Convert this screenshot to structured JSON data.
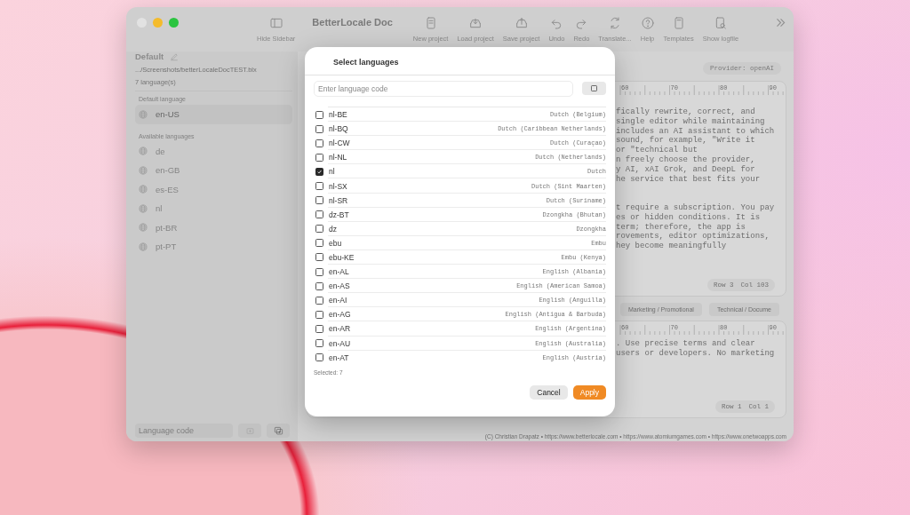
{
  "window": {
    "title": "BetterLocale Doc"
  },
  "toolbar": [
    {
      "kind": "sidebar",
      "label": "Hide Sidebar"
    },
    {
      "kind": "new",
      "label": "New project"
    },
    {
      "kind": "load",
      "label": "Load project"
    },
    {
      "kind": "save",
      "label": "Save project"
    },
    {
      "kind": "undo",
      "label": "Undo"
    },
    {
      "kind": "redo",
      "label": "Redo"
    },
    {
      "kind": "translate",
      "label": "Translate..."
    },
    {
      "kind": "help",
      "label": "Help"
    },
    {
      "kind": "templates",
      "label": "Templates"
    },
    {
      "kind": "logfile",
      "label": "Show logfile"
    }
  ],
  "sidebar": {
    "project": "Default",
    "path": ".../Screenshots/betterLocaleDocTEST.blx",
    "count": "7 language(s)",
    "default_heading": "Default language",
    "default_languages": [
      {
        "code": "en-US",
        "selected": true
      }
    ],
    "available_heading": "Available languages",
    "languages": [
      {
        "code": "de",
        "selected": false
      },
      {
        "code": "en-GB",
        "selected": false
      },
      {
        "code": "es-ES",
        "selected": false
      },
      {
        "code": "nl",
        "selected": false
      },
      {
        "code": "pt-BR",
        "selected": false
      },
      {
        "code": "pt-PT",
        "selected": false
      }
    ],
    "code_field": {
      "placeholder": "Language code"
    }
  },
  "provider": "Provider: openAI",
  "editor": {
    "ruler": [
      "60",
      "70",
      "80",
      "90"
    ],
    "paragraphs": [
      [
        "fically rewrite, correct, and",
        "single editor while maintaining",
        "includes an AI assistant to which",
        "sound, for example, \"Write it",
        "or \"technical but",
        "n freely choose the provider,",
        "y AI, xAI Grok, and DeepL for",
        "he service that best fits your"
      ],
      [
        "t require a subscription. You pay",
        "es or hidden conditions. It is",
        "term; therefore, the app is",
        "rovements, editor optimizations,",
        "hey become meaningfully"
      ]
    ],
    "row": "Row 3",
    "col": "Col 103"
  },
  "tags": [
    "Marketing / Promotional",
    "Technical / Docume"
  ],
  "editor2": {
    "ruler": [
      "60",
      "70",
      "80",
      "90"
    ],
    "lines": [
      ". Use precise terms and clear",
      "users or developers. No marketing"
    ],
    "row": "Row 1",
    "col": "Col 1"
  },
  "footer": "(C) Christian Drapatz • https://www.betterlocale.com • https://www.atomiumgames.com • https://www.onetwoapps.com",
  "dialog": {
    "title": "Select languages",
    "search": {
      "placeholder": "Enter language code"
    },
    "languages": [
      {
        "code": "nl-BE",
        "name": "Dutch (Belgium)",
        "checked": false
      },
      {
        "code": "nl-BQ",
        "name": "Dutch (Caribbean Netherlands)",
        "checked": false
      },
      {
        "code": "nl-CW",
        "name": "Dutch (Curaçao)",
        "checked": false
      },
      {
        "code": "nl-NL",
        "name": "Dutch (Netherlands)",
        "checked": false
      },
      {
        "code": "nl",
        "name": "Dutch",
        "checked": true
      },
      {
        "code": "nl-SX",
        "name": "Dutch (Sint Maarten)",
        "checked": false
      },
      {
        "code": "nl-SR",
        "name": "Dutch (Suriname)",
        "checked": false
      },
      {
        "code": "dz-BT",
        "name": "Dzongkha (Bhutan)",
        "checked": false
      },
      {
        "code": "dz",
        "name": "Dzongkha",
        "checked": false
      },
      {
        "code": "ebu",
        "name": "Embu",
        "checked": false
      },
      {
        "code": "ebu-KE",
        "name": "Embu (Kenya)",
        "checked": false
      },
      {
        "code": "en-AL",
        "name": "English (Albania)",
        "checked": false
      },
      {
        "code": "en-AS",
        "name": "English (American Samoa)",
        "checked": false
      },
      {
        "code": "en-AI",
        "name": "English (Anguilla)",
        "checked": false
      },
      {
        "code": "en-AG",
        "name": "English (Antigua & Barbuda)",
        "checked": false
      },
      {
        "code": "en-AR",
        "name": "English (Argentina)",
        "checked": false
      },
      {
        "code": "en-AU",
        "name": "English (Australia)",
        "checked": false
      },
      {
        "code": "en-AT",
        "name": "English (Austria)",
        "checked": false
      }
    ],
    "selected_count": "Selected: 7",
    "cancel": "Cancel",
    "apply": "Apply"
  }
}
